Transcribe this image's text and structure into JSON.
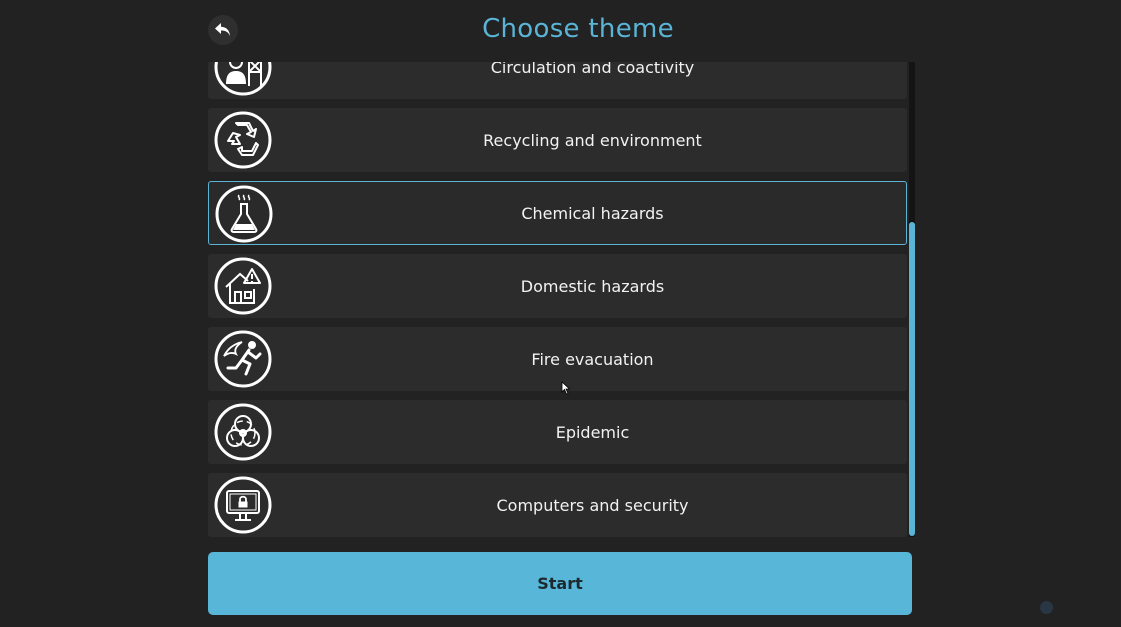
{
  "header": {
    "title": "Choose theme",
    "back_icon": "back-arrow-icon"
  },
  "themes": [
    {
      "label": "Circulation and coactivity",
      "icon": "worker-scaffold-icon",
      "selected": false
    },
    {
      "label": "Recycling and environment",
      "icon": "recycle-icon",
      "selected": false
    },
    {
      "label": "Chemical hazards",
      "icon": "flask-icon",
      "selected": true
    },
    {
      "label": "Domestic hazards",
      "icon": "house-warning-icon",
      "selected": false
    },
    {
      "label": "Fire evacuation",
      "icon": "running-fire-icon",
      "selected": false
    },
    {
      "label": "Epidemic",
      "icon": "biohazard-icon",
      "selected": false
    },
    {
      "label": "Computers and security",
      "icon": "computer-lock-icon",
      "selected": false
    }
  ],
  "start_button": {
    "label": "Start"
  },
  "colors": {
    "accent": "#5ab4d6",
    "background": "#222222",
    "item_background": "#2c2c2c",
    "text": "#f2f2f2"
  }
}
